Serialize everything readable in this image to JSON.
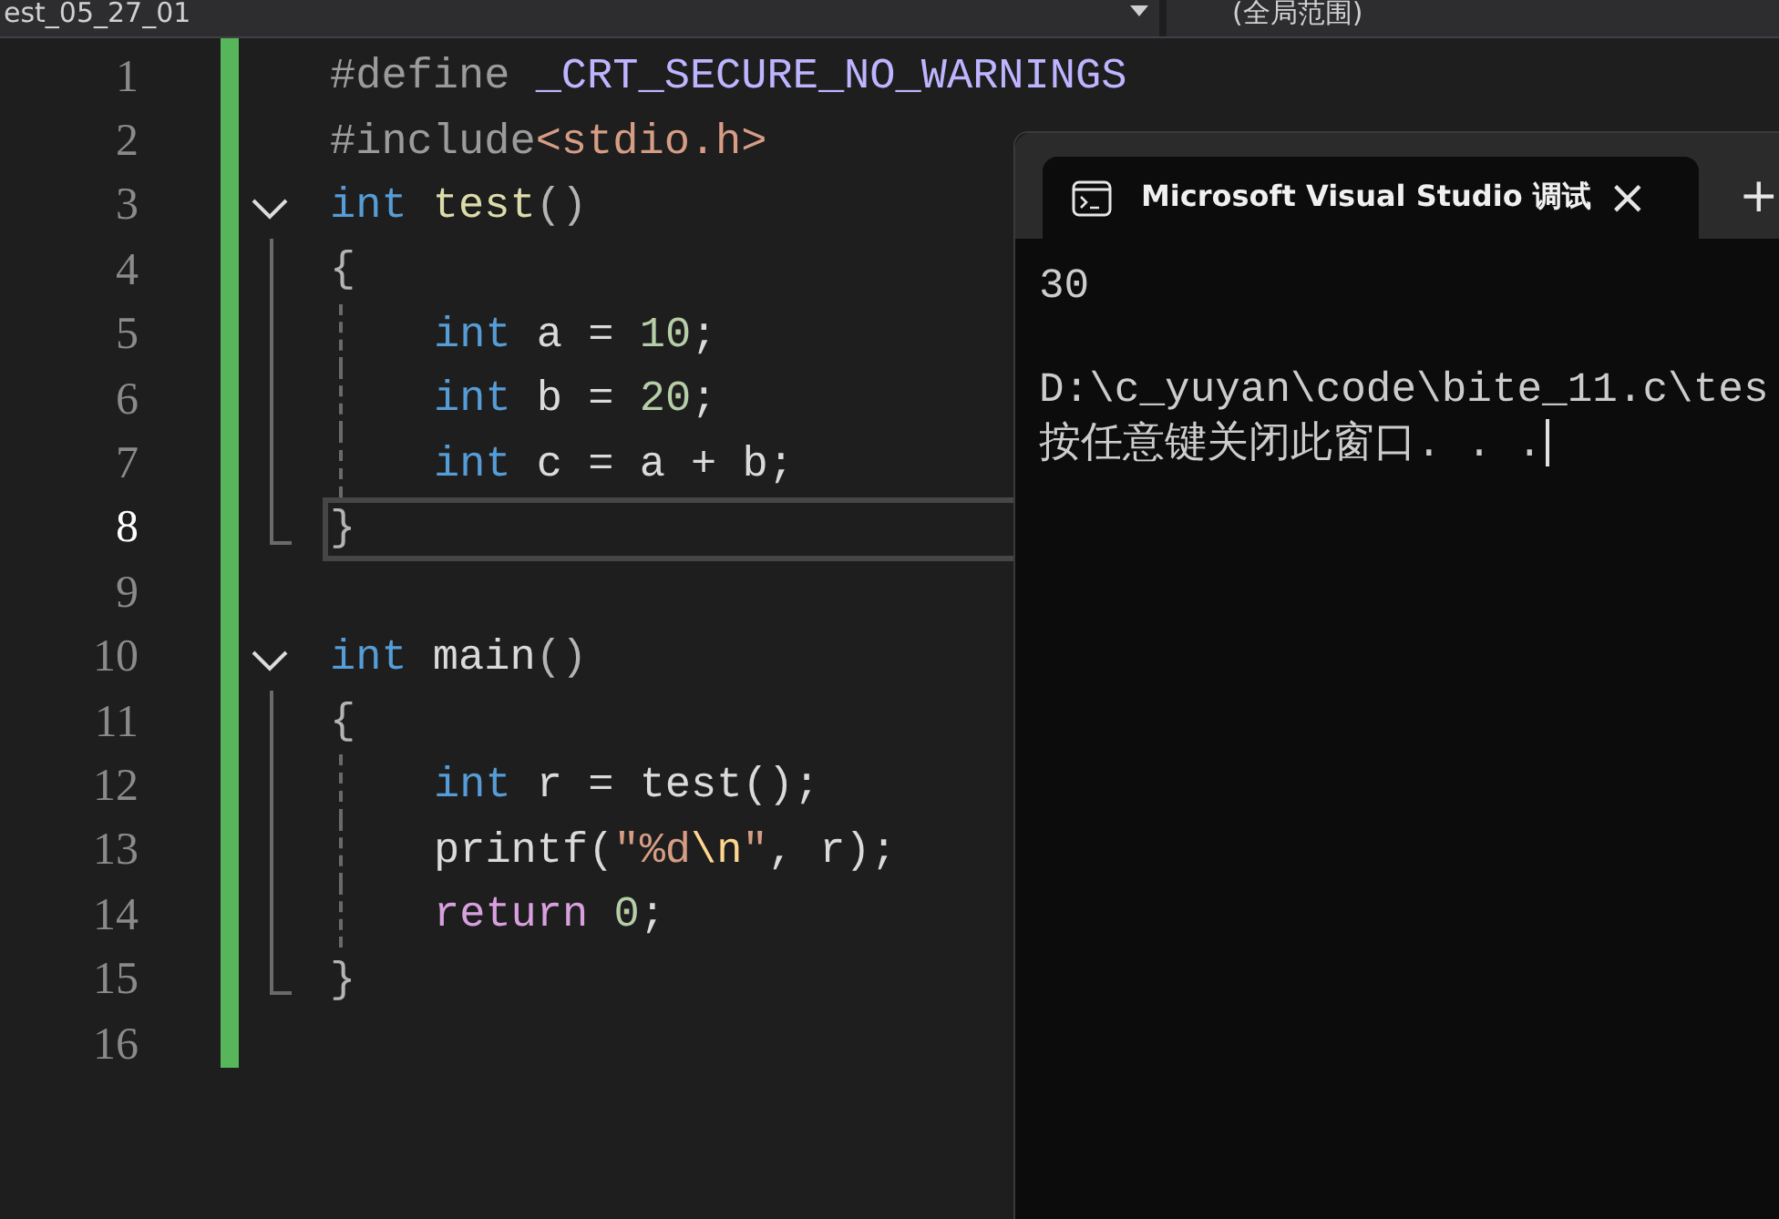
{
  "toolbar": {
    "file_dropdown": "est_05_27_01",
    "scope_dropdown": "(全局范围)"
  },
  "editor": {
    "lines": [
      {
        "number": "1",
        "selected": false,
        "kind": "plain",
        "indented": false,
        "tokens": [
          {
            "kind": "pre",
            "text": "#define "
          },
          {
            "kind": "macro",
            "text": "_CRT_SECURE_NO_WARNINGS"
          }
        ]
      },
      {
        "number": "2",
        "selected": false,
        "kind": "plain",
        "indented": false,
        "tokens": [
          {
            "kind": "pre",
            "text": "#include"
          },
          {
            "kind": "string",
            "text": "<stdio.h>"
          }
        ]
      },
      {
        "number": "3",
        "selected": false,
        "kind": "header",
        "indented": false,
        "tokens": [
          {
            "kind": "keyword",
            "text": "int "
          },
          {
            "kind": "function",
            "text": "test"
          },
          {
            "kind": "punct",
            "text": "()"
          }
        ]
      },
      {
        "number": "4",
        "selected": false,
        "kind": "body",
        "indented": false,
        "tokens": [
          {
            "kind": "punct",
            "text": "{"
          }
        ]
      },
      {
        "number": "5",
        "selected": false,
        "kind": "body",
        "indented": true,
        "tokens": [
          {
            "kind": "keyword",
            "text": "int "
          },
          {
            "kind": "plain",
            "text": "a = "
          },
          {
            "kind": "number",
            "text": "10"
          },
          {
            "kind": "plain",
            "text": ";"
          }
        ]
      },
      {
        "number": "6",
        "selected": false,
        "kind": "body",
        "indented": true,
        "tokens": [
          {
            "kind": "keyword",
            "text": "int "
          },
          {
            "kind": "plain",
            "text": "b = "
          },
          {
            "kind": "number",
            "text": "20"
          },
          {
            "kind": "plain",
            "text": ";"
          }
        ]
      },
      {
        "number": "7",
        "selected": false,
        "kind": "body",
        "indented": true,
        "tokens": [
          {
            "kind": "keyword",
            "text": "int "
          },
          {
            "kind": "plain",
            "text": "c = a + b;"
          }
        ]
      },
      {
        "number": "8",
        "selected": true,
        "kind": "closer",
        "indented": false,
        "tokens": [
          {
            "kind": "punct",
            "text": "}"
          }
        ]
      },
      {
        "number": "9",
        "selected": false,
        "kind": "plain",
        "indented": false
      },
      {
        "number": "10",
        "selected": false,
        "kind": "header",
        "indented": false,
        "tokens": [
          {
            "kind": "keyword",
            "text": "int "
          },
          {
            "kind": "plain",
            "text": "main"
          },
          {
            "kind": "punct",
            "text": "()"
          }
        ]
      },
      {
        "number": "11",
        "selected": false,
        "kind": "body",
        "indented": false,
        "tokens": [
          {
            "kind": "punct",
            "text": "{"
          }
        ]
      },
      {
        "number": "12",
        "selected": false,
        "kind": "body",
        "indented": true,
        "tokens": [
          {
            "kind": "keyword",
            "text": "int "
          },
          {
            "kind": "plain",
            "text": "r = test();"
          }
        ]
      },
      {
        "number": "13",
        "selected": false,
        "kind": "body",
        "indented": true,
        "tokens": [
          {
            "kind": "plain",
            "text": "printf("
          },
          {
            "kind": "string",
            "text": "\"%d"
          },
          {
            "kind": "escape",
            "text": "\\n"
          },
          {
            "kind": "string",
            "text": "\""
          },
          {
            "kind": "plain",
            "text": ", r);"
          }
        ]
      },
      {
        "number": "14",
        "selected": false,
        "kind": "body",
        "indented": true,
        "tokens": [
          {
            "kind": "control",
            "text": "return "
          },
          {
            "kind": "number",
            "text": "0"
          },
          {
            "kind": "plain",
            "text": ";"
          }
        ]
      },
      {
        "number": "15",
        "selected": false,
        "kind": "closer",
        "indented": false,
        "tokens": [
          {
            "kind": "punct",
            "text": "}"
          }
        ]
      },
      {
        "number": "16",
        "selected": false,
        "kind": "plain",
        "indented": false
      }
    ]
  },
  "terminal": {
    "tab_title": "Microsoft Visual Studio 调试",
    "close": "×",
    "new_tab": "+",
    "result": "30",
    "path": "D:\\c_yuyan\\code\\bite_11.c\\tes",
    "prompt": "按任意键关闭此窗口. . ."
  }
}
